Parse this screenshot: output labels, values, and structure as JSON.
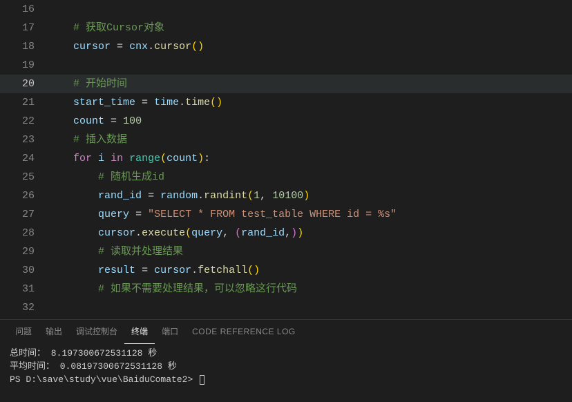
{
  "editor": {
    "activeLine": 20,
    "lines": [
      {
        "num": 16,
        "indent": 1,
        "tokens": []
      },
      {
        "num": 17,
        "indent": 1,
        "tokens": [
          {
            "c": "comment",
            "t": "# 获取Cursor对象"
          }
        ]
      },
      {
        "num": 18,
        "indent": 1,
        "tokens": [
          {
            "c": "variable",
            "t": "cursor"
          },
          {
            "c": "plain",
            "t": " "
          },
          {
            "c": "operator",
            "t": "="
          },
          {
            "c": "plain",
            "t": " "
          },
          {
            "c": "variable",
            "t": "cnx"
          },
          {
            "c": "plain",
            "t": "."
          },
          {
            "c": "funccall",
            "t": "cursor"
          },
          {
            "c": "paren",
            "t": "()"
          }
        ]
      },
      {
        "num": 19,
        "indent": 0,
        "tokens": []
      },
      {
        "num": 20,
        "indent": 1,
        "tokens": [
          {
            "c": "comment",
            "t": "# 开始时间"
          }
        ]
      },
      {
        "num": 21,
        "indent": 1,
        "tokens": [
          {
            "c": "variable",
            "t": "start_time"
          },
          {
            "c": "plain",
            "t": " "
          },
          {
            "c": "operator",
            "t": "="
          },
          {
            "c": "plain",
            "t": " "
          },
          {
            "c": "variable",
            "t": "time"
          },
          {
            "c": "plain",
            "t": "."
          },
          {
            "c": "funccall",
            "t": "time"
          },
          {
            "c": "paren",
            "t": "()"
          }
        ]
      },
      {
        "num": 22,
        "indent": 1,
        "tokens": [
          {
            "c": "variable",
            "t": "count"
          },
          {
            "c": "plain",
            "t": " "
          },
          {
            "c": "operator",
            "t": "="
          },
          {
            "c": "plain",
            "t": " "
          },
          {
            "c": "number",
            "t": "100"
          }
        ]
      },
      {
        "num": 23,
        "indent": 1,
        "tokens": [
          {
            "c": "comment",
            "t": "# 插入数据"
          }
        ]
      },
      {
        "num": 24,
        "indent": 1,
        "tokens": [
          {
            "c": "keyword",
            "t": "for"
          },
          {
            "c": "plain",
            "t": " "
          },
          {
            "c": "variable",
            "t": "i"
          },
          {
            "c": "plain",
            "t": " "
          },
          {
            "c": "keyword",
            "t": "in"
          },
          {
            "c": "plain",
            "t": " "
          },
          {
            "c": "builtin",
            "t": "range"
          },
          {
            "c": "paren",
            "t": "("
          },
          {
            "c": "variable",
            "t": "count"
          },
          {
            "c": "paren",
            "t": ")"
          },
          {
            "c": "plain",
            "t": ":"
          }
        ]
      },
      {
        "num": 25,
        "indent": 2,
        "tokens": [
          {
            "c": "comment",
            "t": "# 随机生成id"
          }
        ]
      },
      {
        "num": 26,
        "indent": 2,
        "tokens": [
          {
            "c": "variable",
            "t": "rand_id"
          },
          {
            "c": "plain",
            "t": " "
          },
          {
            "c": "operator",
            "t": "="
          },
          {
            "c": "plain",
            "t": " "
          },
          {
            "c": "variable",
            "t": "random"
          },
          {
            "c": "plain",
            "t": "."
          },
          {
            "c": "funccall",
            "t": "randint"
          },
          {
            "c": "paren",
            "t": "("
          },
          {
            "c": "number",
            "t": "1"
          },
          {
            "c": "plain",
            "t": ", "
          },
          {
            "c": "number",
            "t": "10100"
          },
          {
            "c": "paren",
            "t": ")"
          }
        ]
      },
      {
        "num": 27,
        "indent": 2,
        "tokens": [
          {
            "c": "variable",
            "t": "query"
          },
          {
            "c": "plain",
            "t": " "
          },
          {
            "c": "operator",
            "t": "="
          },
          {
            "c": "plain",
            "t": " "
          },
          {
            "c": "string",
            "t": "\"SELECT * FROM test_table WHERE id = %s\""
          }
        ]
      },
      {
        "num": 28,
        "indent": 2,
        "tokens": [
          {
            "c": "variable",
            "t": "cursor"
          },
          {
            "c": "plain",
            "t": "."
          },
          {
            "c": "funccall",
            "t": "execute"
          },
          {
            "c": "paren",
            "t": "("
          },
          {
            "c": "variable",
            "t": "query"
          },
          {
            "c": "plain",
            "t": ", "
          },
          {
            "c": "paren2",
            "t": "("
          },
          {
            "c": "variable",
            "t": "rand_id"
          },
          {
            "c": "plain",
            "t": ","
          },
          {
            "c": "paren2",
            "t": ")"
          },
          {
            "c": "paren",
            "t": ")"
          }
        ]
      },
      {
        "num": 29,
        "indent": 2,
        "tokens": [
          {
            "c": "comment",
            "t": "# 读取并处理结果"
          }
        ]
      },
      {
        "num": 30,
        "indent": 2,
        "tokens": [
          {
            "c": "variable",
            "t": "result"
          },
          {
            "c": "plain",
            "t": " "
          },
          {
            "c": "operator",
            "t": "="
          },
          {
            "c": "plain",
            "t": " "
          },
          {
            "c": "variable",
            "t": "cursor"
          },
          {
            "c": "plain",
            "t": "."
          },
          {
            "c": "funccall",
            "t": "fetchall"
          },
          {
            "c": "paren",
            "t": "()"
          }
        ]
      },
      {
        "num": 31,
        "indent": 2,
        "tokens": [
          {
            "c": "comment",
            "t": "# 如果不需要处理结果，可以忽略这行代码"
          }
        ]
      },
      {
        "num": 32,
        "indent": 0,
        "tokens": []
      }
    ]
  },
  "panel": {
    "tabs": {
      "problems": "问题",
      "output": "输出",
      "debugConsole": "调试控制台",
      "terminal": "终端",
      "ports": "端口",
      "codeRefLog": "CODE REFERENCE LOG"
    },
    "activeTab": "terminal",
    "terminal": {
      "line1": "总时间： 8.197300672531128 秒",
      "line2": "平均时间： 0.08197300672531128 秒",
      "promptPath": "PS D:\\save\\study\\vue\\BaiduComate2>"
    }
  }
}
